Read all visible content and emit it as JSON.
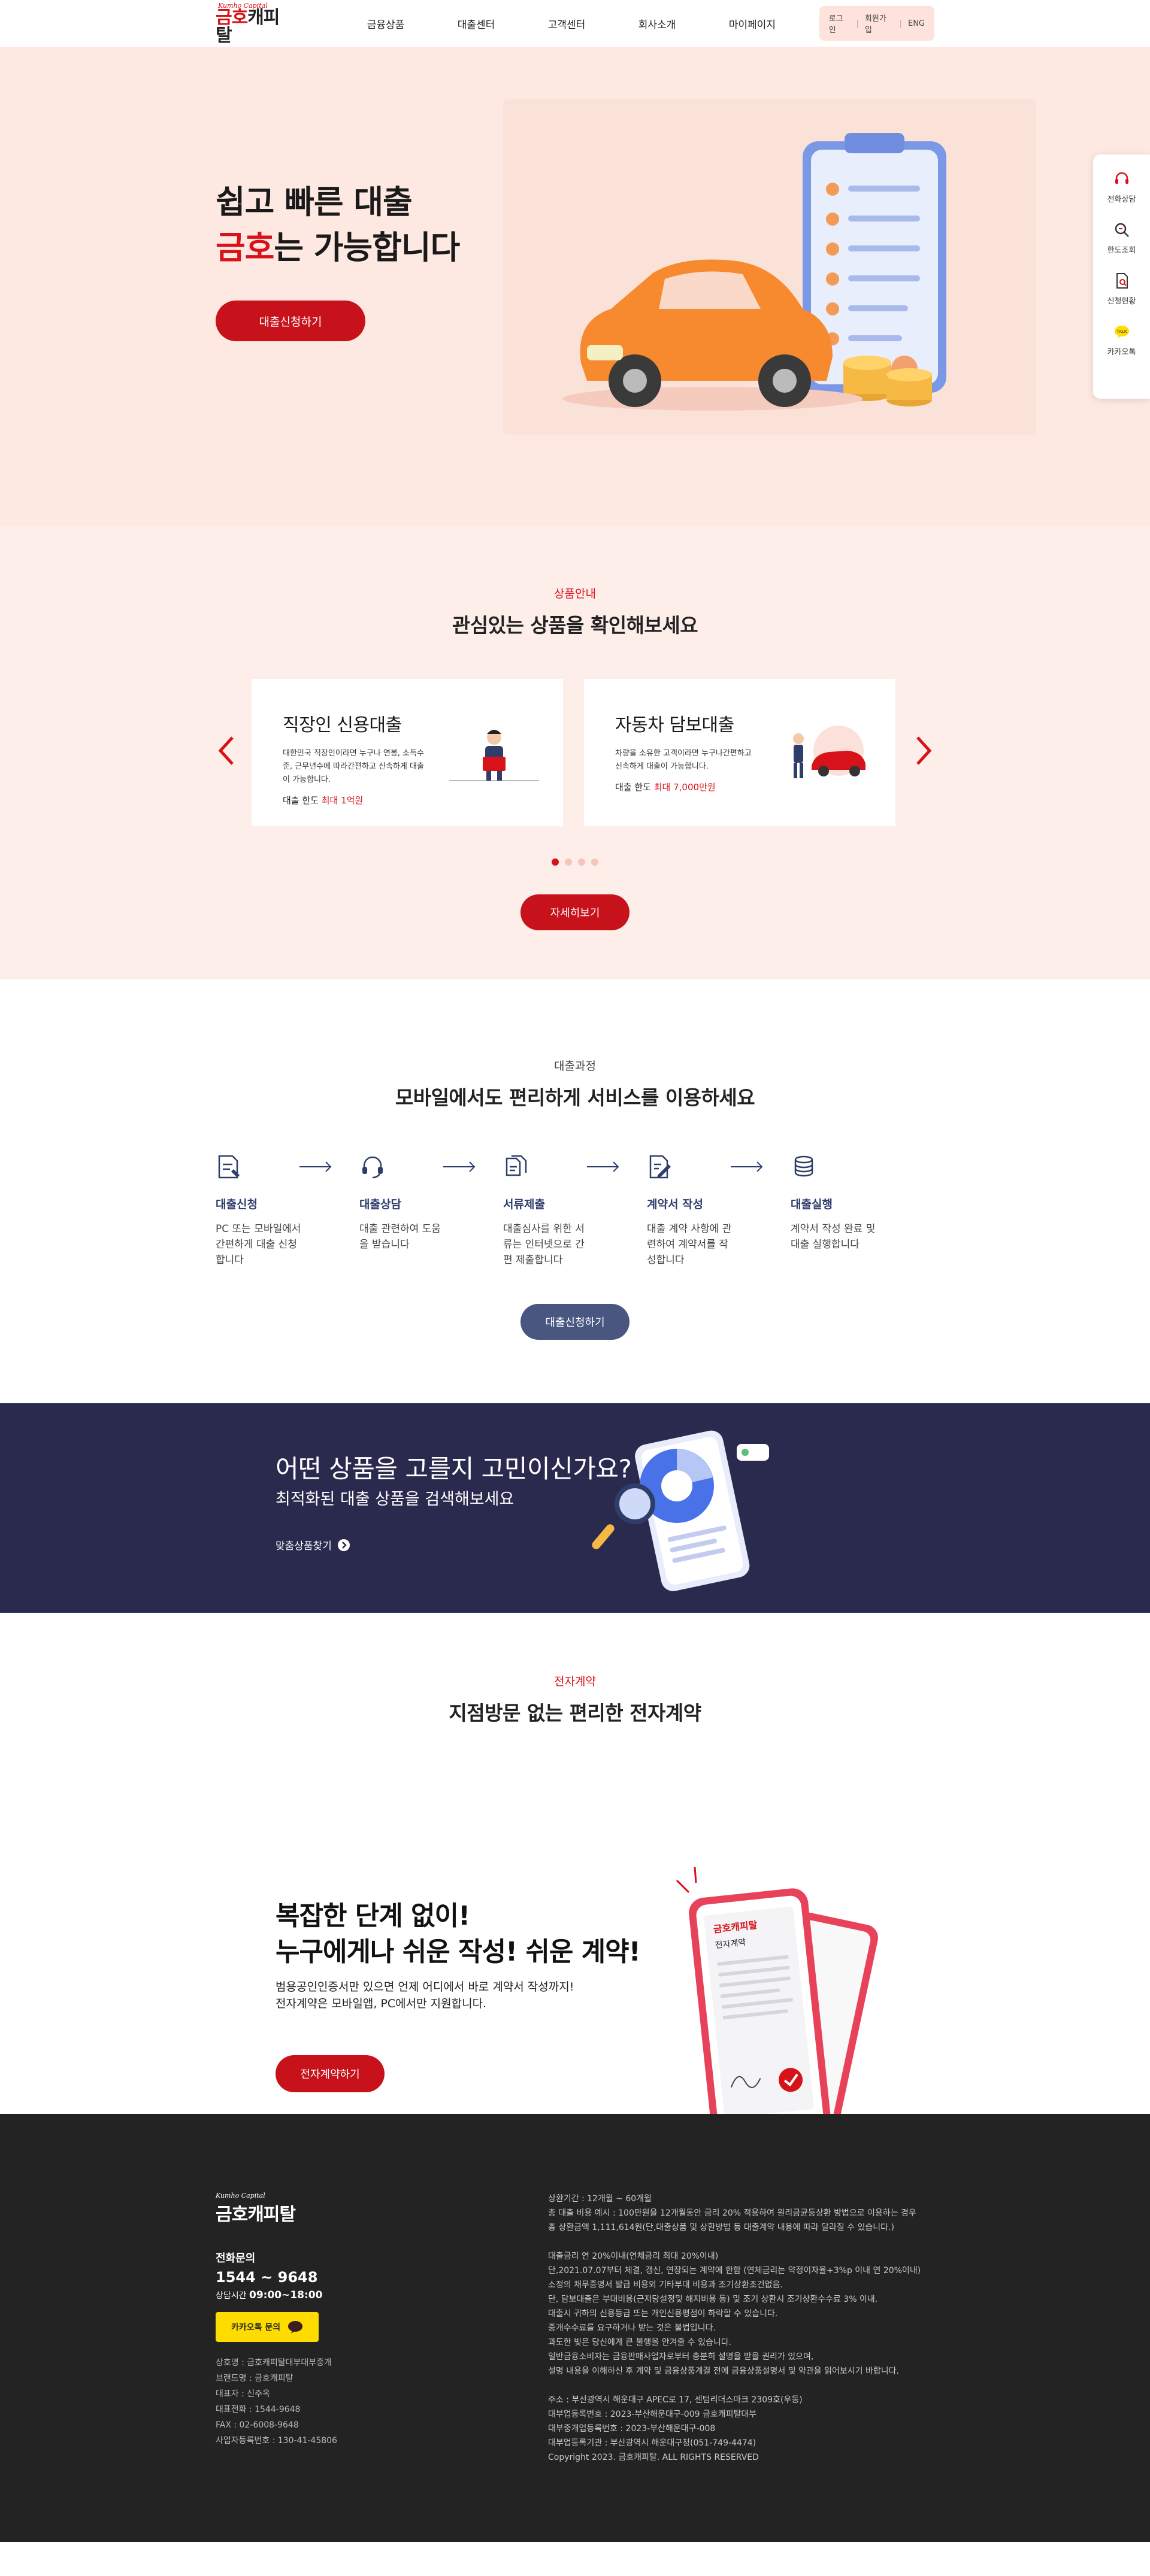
{
  "header": {
    "logo_en": "Kumho Capital",
    "logo_ko_red": "금호",
    "logo_ko_rest": "캐피탈",
    "nav": [
      "금융상품",
      "대출센터",
      "고객센터",
      "회사소개",
      "마이페이지"
    ],
    "util": {
      "login": "로그인",
      "join": "회원가입",
      "lang": "ENG"
    }
  },
  "hero": {
    "title_line1": "쉽고 빠른 대출",
    "title_red": "금호",
    "title_rest": "는 가능합니다",
    "cta": "대출신청하기"
  },
  "quick_menu": [
    {
      "icon": "headset-icon",
      "label": "전화상담"
    },
    {
      "icon": "search-icon",
      "label": "한도조회"
    },
    {
      "icon": "document-search-icon",
      "label": "신청현황"
    },
    {
      "icon": "kakao-icon",
      "label": "카카오톡"
    }
  ],
  "products": {
    "eyebrow": "상품안내",
    "title": "관심있는 상품을 확인해보세요",
    "cards": [
      {
        "title": "직장인 신용대출",
        "desc": "대한민국 직장인이라면 누구나 연봉, 소득수준, 근무년수에 따라간편하고 신속하게 대출이 가능합니다.",
        "limit_label": "대출 한도",
        "limit_value": "최대 1억원"
      },
      {
        "title": "자동차 담보대출",
        "desc": "차량을 소유한 고객이라면 누구나간편하고 신속하게 대출이 가능합니다.",
        "limit_label": "대출 한도",
        "limit_value": "최대 7,000만원"
      }
    ],
    "more": "자세히보기"
  },
  "process": {
    "eyebrow": "대출과정",
    "title": "모바일에서도 편리하게 서비스를 이용하세요",
    "steps": [
      {
        "icon": "form-icon",
        "title": "대출신청",
        "desc": "PC 또는 모바일에서 간편하게 대출 신청합니다"
      },
      {
        "icon": "headset-icon",
        "title": "대출상담",
        "desc": "대출 관련하여 도움을 받습니다"
      },
      {
        "icon": "files-icon",
        "title": "서류제출",
        "desc": "대출심사를 위한 서류는 인터넷으로 간편 제출합니다"
      },
      {
        "icon": "pen-document-icon",
        "title": "계약서 작성",
        "desc": "대출 계약 사항에 관련하여 계약서를 작성합니다"
      },
      {
        "icon": "coins-icon",
        "title": "대출실행",
        "desc": "계약서 작성 완료 및 대출 실행합니다"
      }
    ],
    "cta": "대출신청하기"
  },
  "banner": {
    "title": "어떤 상품을 고를지 고민이신가요?",
    "subtitle": "최적화된 대출 상품을 검색해보세요",
    "link": "맞춤상품찾기"
  },
  "contract": {
    "eyebrow": "전자계약",
    "title": "지점방문 없는 편리한 전자계약",
    "headline1": "복잡한 단계 없이!",
    "headline2": "누구에게나 쉬운 작성! 쉬운 계약!",
    "desc1": "범용공인인증서만 있으면 언제 어디에서 바로 계약서 작성까지!",
    "desc2": "전자계약은 모바일앱, PC에서만 지원합니다.",
    "cta": "전자계약하기",
    "doc_label": "전자계약",
    "doc_logo": "금호캐피탈"
  },
  "footer": {
    "logo_en": "Kumho Capital",
    "logo": "금호캐피탈",
    "tel_label": "전화문의",
    "tel": "1544 ~ 9648",
    "hours_label": "상담시간",
    "hours": "09:00~18:00",
    "kakao": "카카오톡 문의",
    "info": [
      "상호명 : 금호캐피탈대부대부중개",
      "브랜드명 : 금호캐피탈",
      "대표자 : 신주옥",
      "대표전화 : 1544-9648",
      "FAX : 02-6008-9648",
      "사업자등록번호 : 130-41-45806"
    ],
    "notes_a": [
      "상환기간 : 12개월 ~ 60개월",
      "총 대출 비용 예시 : 100만원을 12개월동안 금리 20% 적용하여 원리금균등상환 방법으로 이용하는 경우",
      "총 상환금액 1,111,614원(단,대출상품 및 상환방법 등 대출계약 내용에 따라 달라질 수 있습니다.)"
    ],
    "notes_b": [
      "대출금리 연 20%이내(연체금리 최대 20%이내)",
      "단,2021.07.07부터 체결, 갱신, 연장되는 계약에 한함 (연체금리는 약정이자율+3%p 이내 연 20%이내)",
      "소정의 채무증명서 발급 비용외 기타부대 비용과 조기상환조건없음.",
      "단, 담보대출은 부대비용(근저당설정및 해지비용 등) 및 조기 상환시 조기상환수수료 3% 이내.",
      "대출시 귀하의 신용등급 또는 개인신용평점이 하락할 수 있습니다.",
      "중개수수료를 요구하거나 받는 것은 불법입니다.",
      "과도한 빚은 당신에게 큰 불행을 안겨줄 수 있습니다.",
      "일반금융소비자는 금융판매사업자로부터 충분히 설명을 받을 권리가 있으며,",
      "설명 내용을 이해하신 후 계약 및 금융상품계결 전에 금융상품설명서 및 약관을 읽어보시기 바랍니다."
    ],
    "notes_c": [
      "주소 : 부산광역시 해운대구 APEC로 17, 센텀리더스마크 2309호(우동)",
      "대부업등록번호 : 2023-부산해운대구-009 금호캐피탈대부",
      "대부중개업등록번호 : 2023-부산해운대구-008",
      "대부업등록기관 : 부산광역시 해운대구청(051-749-4474)",
      "Copyright 2023. 금호캐피탈. ALL RIGHTS RESERVED"
    ]
  }
}
